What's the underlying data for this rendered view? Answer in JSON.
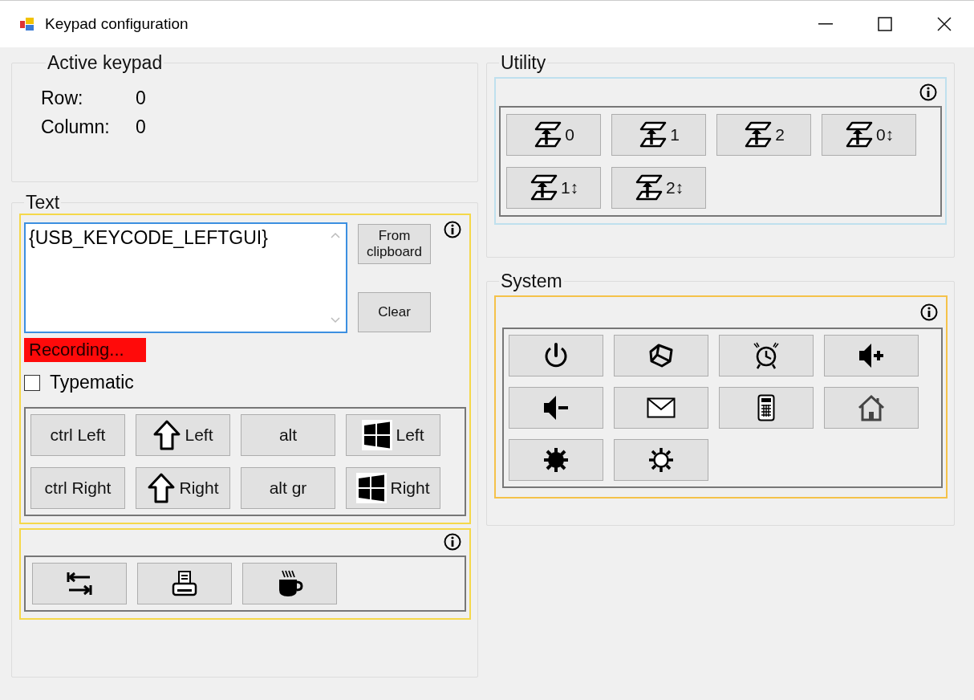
{
  "window": {
    "title": "Keypad configuration"
  },
  "active_keypad": {
    "title": "Active keypad",
    "fields": [
      {
        "label": "Row:",
        "value": "0"
      },
      {
        "label": "Column:",
        "value": "0"
      }
    ]
  },
  "text": {
    "title": "Text",
    "value": "{USB_KEYCODE_LEFTGUI}",
    "buttons": [
      "From clipboard",
      "Clear"
    ],
    "status": "Recording...",
    "typematic": {
      "label": "Typematic",
      "checked": false
    },
    "modifier_keys": [
      {
        "kind": "text",
        "label": "ctrl Left"
      },
      {
        "kind": "shift",
        "label": "Left"
      },
      {
        "kind": "text",
        "label": "alt"
      },
      {
        "kind": "windows",
        "label": "Left"
      },
      {
        "kind": "text",
        "label": "ctrl Right"
      },
      {
        "kind": "shift",
        "label": "Right"
      },
      {
        "kind": "text",
        "label": "alt gr"
      },
      {
        "kind": "windows",
        "label": "Right"
      }
    ],
    "special_keys": [
      {
        "kind": "tab"
      },
      {
        "kind": "printer"
      },
      {
        "kind": "coffee"
      }
    ]
  },
  "utility": {
    "title": "Utility",
    "keys": [
      {
        "kind": "layer",
        "label": "0"
      },
      {
        "kind": "layer",
        "label": "1"
      },
      {
        "kind": "layer",
        "label": "2"
      },
      {
        "kind": "layer",
        "label": "0↕"
      },
      {
        "kind": "layer",
        "label": "1↕"
      },
      {
        "kind": "layer",
        "label": "2↕"
      }
    ]
  },
  "system": {
    "title": "System",
    "keys": [
      {
        "kind": "power"
      },
      {
        "kind": "sleep"
      },
      {
        "kind": "alarm"
      },
      {
        "kind": "volume_up"
      },
      {
        "kind": "volume_down"
      },
      {
        "kind": "mail"
      },
      {
        "kind": "calculator"
      },
      {
        "kind": "home"
      },
      {
        "kind": "brightness_up"
      },
      {
        "kind": "brightness_down"
      }
    ]
  }
}
